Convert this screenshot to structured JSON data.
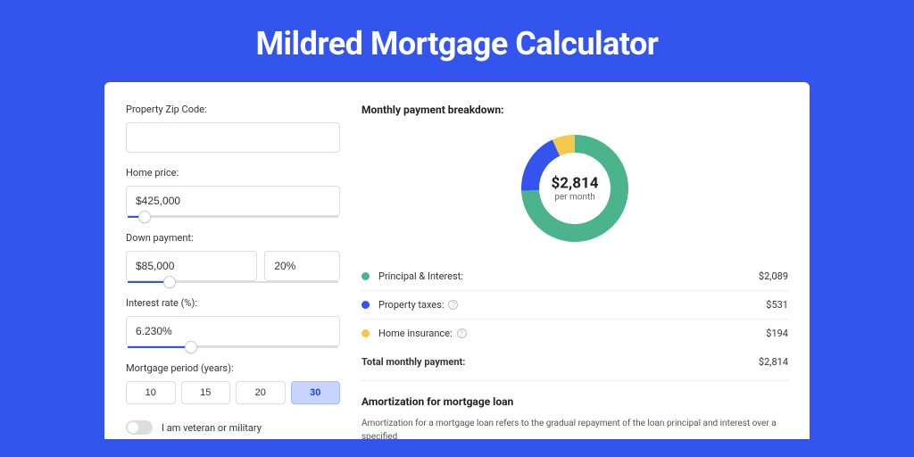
{
  "page_title": "Mildred Mortgage Calculator",
  "form": {
    "zip_label": "Property Zip Code:",
    "zip_value": "",
    "home_price_label": "Home price:",
    "home_price_value": "$425,000",
    "home_price_slider_pct": 8,
    "down_payment_label": "Down payment:",
    "down_payment_amount": "$85,000",
    "down_payment_pct": "20%",
    "down_payment_slider_pct": 20,
    "interest_label": "Interest rate (%):",
    "interest_value": "6.230%",
    "interest_slider_pct": 30,
    "period_label": "Mortgage period (years):",
    "period_options": [
      "10",
      "15",
      "20",
      "30"
    ],
    "period_active_index": 3,
    "veteran_label": "I am veteran or military"
  },
  "breakdown": {
    "title": "Monthly payment breakdown:",
    "donut_value": "$2,814",
    "donut_sub": "per month",
    "items": [
      {
        "label": "Principal & Interest:",
        "value": "$2,089",
        "color": "#4bb48d",
        "info": false
      },
      {
        "label": "Property taxes:",
        "value": "$531",
        "color": "#3355ee",
        "info": true
      },
      {
        "label": "Home insurance:",
        "value": "$194",
        "color": "#f2c94c",
        "info": true
      }
    ],
    "total_label": "Total monthly payment:",
    "total_value": "$2,814"
  },
  "amortization": {
    "title": "Amortization for mortgage loan",
    "text": "Amortization for a mortgage loan refers to the gradual repayment of the loan principal and interest over a specified"
  },
  "chart_data": {
    "type": "pie",
    "title": "Monthly payment breakdown",
    "series": [
      {
        "name": "Principal & Interest",
        "value": 2089,
        "color": "#4bb48d"
      },
      {
        "name": "Property taxes",
        "value": 531,
        "color": "#3355ee"
      },
      {
        "name": "Home insurance",
        "value": 194,
        "color": "#f2c94c"
      }
    ],
    "total": 2814,
    "center_label": "$2,814 per month"
  }
}
